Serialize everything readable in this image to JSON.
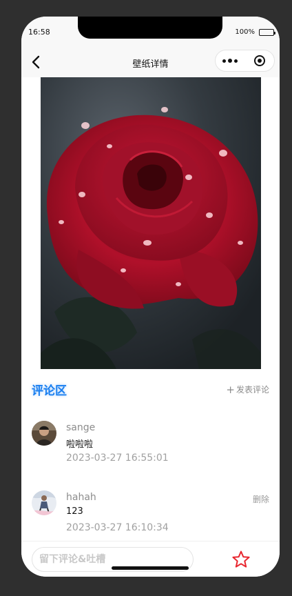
{
  "status_bar": {
    "time": "16:58",
    "battery": "100%"
  },
  "nav": {
    "title": "壁纸详情"
  },
  "comments": {
    "title": "评论区",
    "add_label": "发表评论",
    "items": [
      {
        "user": "sange",
        "text": "啦啦啦",
        "time": "2023-03-27 16:55:01",
        "delete_label": ""
      },
      {
        "user": "hahah",
        "text": "123",
        "time": "2023-03-27 16:10:34",
        "delete_label": "删除"
      }
    ]
  },
  "bottom": {
    "input_placeholder": "留下评论&吐槽"
  },
  "colors": {
    "accent": "#1a7ff0",
    "favorite": "#e8262f"
  }
}
